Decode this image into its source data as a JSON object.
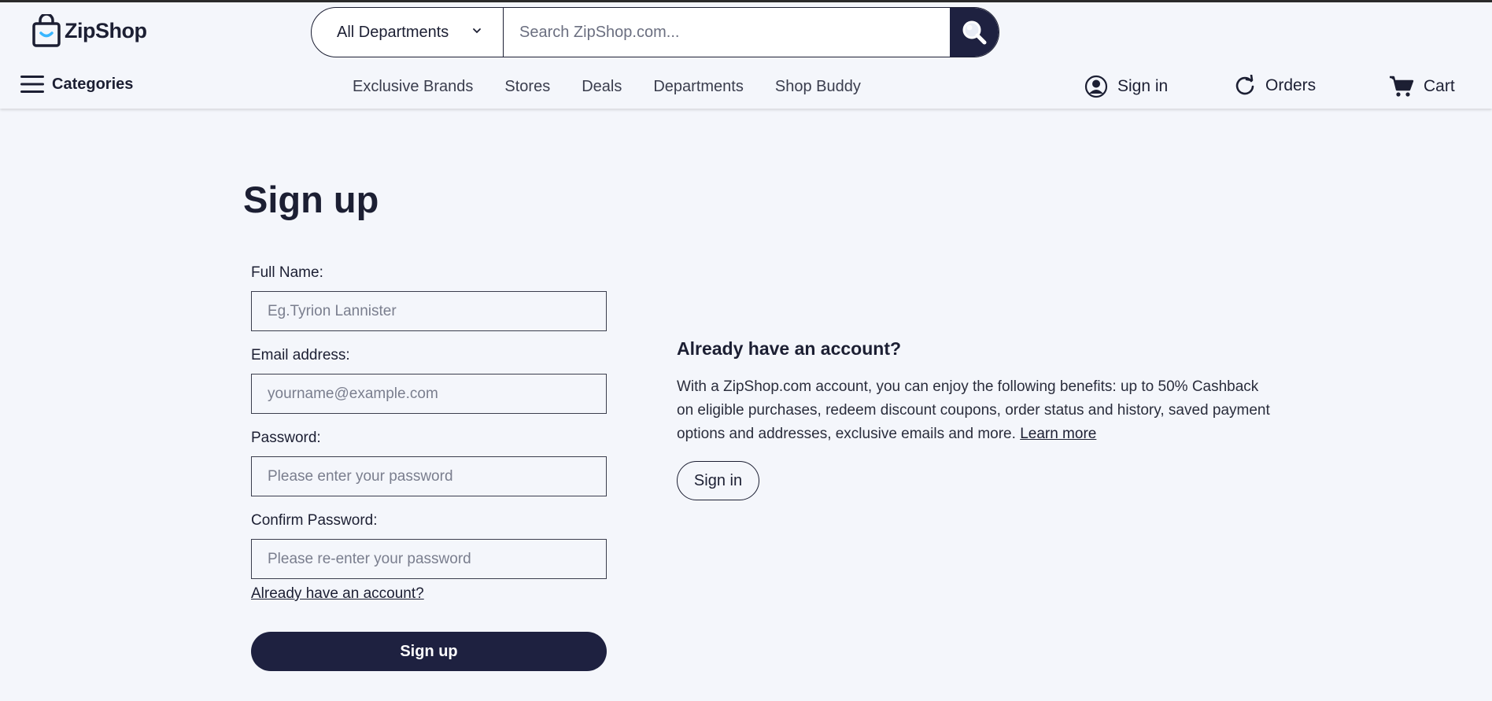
{
  "brand": {
    "name": "ZipShop",
    "accent": "#1e2140",
    "logo_smile": "#38b6ff"
  },
  "search": {
    "department": "All Departments",
    "placeholder": "Search ZipShop.com..."
  },
  "nav": {
    "categories_label": "Categories",
    "links": [
      "Exclusive Brands",
      "Stores",
      "Deals",
      "Departments",
      "Shop Buddy"
    ],
    "sign_in": "Sign in",
    "orders": "Orders",
    "cart": "Cart"
  },
  "signup": {
    "title": "Sign up",
    "full_name": {
      "label": "Full Name:",
      "placeholder": "Eg.Tyrion Lannister"
    },
    "email": {
      "label": "Email address:",
      "placeholder": "yourname@example.com"
    },
    "password": {
      "label": "Password:",
      "placeholder": "Please enter your password"
    },
    "confirm": {
      "label": "Confirm Password:",
      "placeholder": "Please re-enter your password"
    },
    "already_link": "Already have an account?",
    "submit": "Sign up"
  },
  "side": {
    "title": "Already have an account?",
    "text": "With a ZipShop.com account, you can enjoy the following benefits: up to 50% Cashback on eligible purchases, redeem discount coupons, order status and history, saved payment options and addresses, exclusive emails and more. ",
    "learn_more": "Learn more",
    "sign_in": "Sign in"
  }
}
